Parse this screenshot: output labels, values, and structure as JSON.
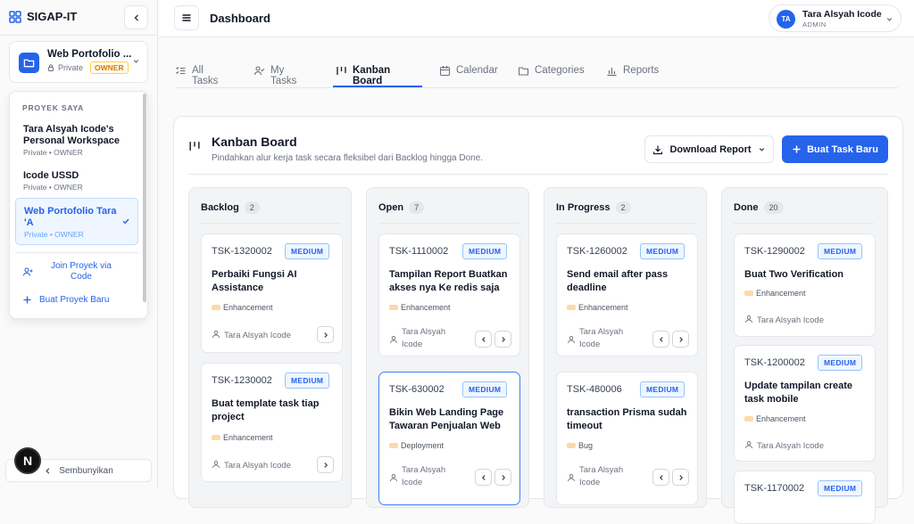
{
  "sidebar": {
    "brand": "SIGAP-IT",
    "project": {
      "name": "Web Portofolio ...",
      "visibility": "Private",
      "role": "OWNER"
    },
    "dropdown": {
      "heading": "PROYEK SAYA",
      "items": [
        {
          "title": "Tara Alsyah Icode's Personal Workspace",
          "meta": "Private • OWNER",
          "active": false
        },
        {
          "title": "Icode USSD",
          "meta": "Private • OWNER",
          "active": false
        },
        {
          "title": "Web Portofolio Tara 'A",
          "meta": "Private • OWNER",
          "active": true
        }
      ],
      "join_label": "Join Proyek via Code",
      "new_label": "Buat Proyek Baru"
    },
    "hide_label": "Sembunyikan",
    "dev_badge": "N"
  },
  "topbar": {
    "title": "Dashboard",
    "user": {
      "initials": "TA",
      "name": "Tara Alsyah Icode",
      "role": "ADMIN"
    }
  },
  "tabs": [
    {
      "label": "All Tasks",
      "icon": "list-checks-icon"
    },
    {
      "label": "My Tasks",
      "icon": "user-check-icon"
    },
    {
      "label": "Kanban Board",
      "icon": "kanban-icon",
      "active": true
    },
    {
      "label": "Calendar",
      "icon": "calendar-icon"
    },
    {
      "label": "Categories",
      "icon": "folder-icon"
    },
    {
      "label": "Reports",
      "icon": "bar-chart-icon"
    }
  ],
  "board": {
    "title": "Kanban Board",
    "subtitle": "Pindahkan alur kerja task secara fleksibel dari Backlog hingga Done.",
    "download_label": "Download Report",
    "new_task_label": "Buat Task Baru",
    "columns": [
      {
        "name": "Backlog",
        "count": "2",
        "cards": [
          {
            "id": "TSK-1320002",
            "priority": "MEDIUM",
            "title": "Perbaiki Fungsi AI Assistance",
            "category": "Enhancement",
            "assignee": "Tara Alsyah Icode"
          },
          {
            "id": "TSK-1230002",
            "priority": "MEDIUM",
            "title": "Buat template task tiap project",
            "category": "Enhancement",
            "assignee": "Tara Alsyah Icode"
          }
        ]
      },
      {
        "name": "Open",
        "count": "7",
        "cards": [
          {
            "id": "TSK-1110002",
            "priority": "MEDIUM",
            "title": "Tampilan Report Buatkan akses nya Ke redis saja",
            "category": "Enhancement",
            "assignee": "Tara Alsyah Icode"
          },
          {
            "id": "TSK-630002",
            "priority": "MEDIUM",
            "title": "Bikin Web Landing Page Tawaran Penjualan Web",
            "category": "Deployment",
            "assignee": "Tara Alsyah Icode"
          }
        ]
      },
      {
        "name": "In Progress",
        "count": "2",
        "cards": [
          {
            "id": "TSK-1260002",
            "priority": "MEDIUM",
            "title": "Send email after pass deadline",
            "category": "Enhancement",
            "assignee": "Tara Alsyah Icode"
          },
          {
            "id": "TSK-480006",
            "priority": "MEDIUM",
            "title": "transaction Prisma sudah timeout",
            "category": "Bug",
            "assignee": "Tara Alsyah Icode"
          }
        ]
      },
      {
        "name": "Done",
        "count": "20",
        "cards": [
          {
            "id": "TSK-1290002",
            "priority": "MEDIUM",
            "title": "Buat Two Verification",
            "category": "Enhancement",
            "assignee": "Tara Alsyah Icode"
          },
          {
            "id": "TSK-1200002",
            "priority": "MEDIUM",
            "title": "Update tampilan create task mobile",
            "category": "Enhancement",
            "assignee": "Tara Alsyah Icode"
          },
          {
            "id": "TSK-1170002",
            "priority": "MEDIUM",
            "title": "",
            "category": "",
            "assignee": ""
          }
        ]
      }
    ]
  },
  "colors": {
    "accent": "#2563eb",
    "owner_badge": "#d97706",
    "category_swatch": "#fcd9a8"
  }
}
